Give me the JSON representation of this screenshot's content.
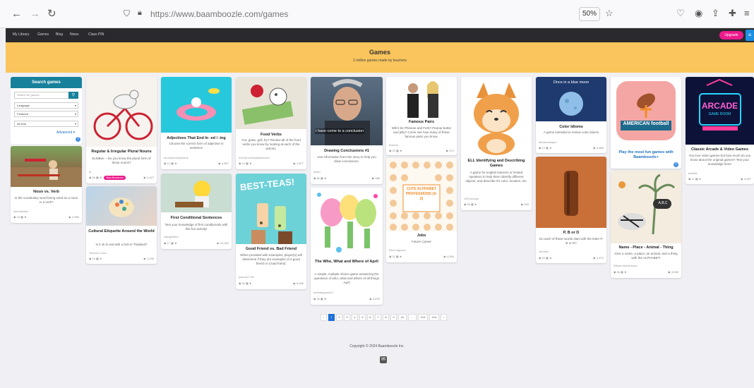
{
  "browser": {
    "url": "https://www.baamboozle.com/games",
    "zoom": "50%",
    "icons": [
      "back-arrow-icon",
      "forward-arrow-icon",
      "reload-icon",
      "shield-icon",
      "lock-icon",
      "star-icon",
      "pocket-icon",
      "account-icon",
      "share-icon",
      "extensions-icon",
      "menu-icon"
    ]
  },
  "nav": {
    "links": [
      "My Library",
      "Games",
      "Blog",
      "News",
      "Class PIN"
    ],
    "upgrade": "Upgrade",
    "menu_icon": "hamburger-icon"
  },
  "hero": {
    "title": "Games",
    "subtitle": "2 million games made by teachers"
  },
  "search": {
    "heading": "Search games",
    "placeholder": "Search for games",
    "language": "Language",
    "sort": "Featured",
    "time": "All time",
    "advanced": "Advanced",
    "help": "?"
  },
  "cards": [
    {
      "title": "Noun vs. Verb",
      "desc": "Is the vocabulary word being used as a noun or a verb?",
      "author": "wendaletele",
      "stats": "24",
      "plays": "2,980"
    },
    {
      "title": "Regular & Irregular Plural Nouns",
      "desc": "ELMBee – Do you know the plural form of these nouns?",
      "author": "bj",
      "stats": "9k",
      "badge": "Baa-Bonanza",
      "plays": "1,427"
    },
    {
      "title": "Cultural Etiquette Around the World",
      "desc": "Is it ok to eat with a fork in Thailand?",
      "author": "Teacher Cass",
      "stats": "1k",
      "plays": "1,239"
    },
    {
      "title": "Adjectives That End In -ed / -ing",
      "desc": "Choose the correct form of adjective in sentence",
      "author": "anonymousbyname",
      "stats": "12",
      "plays": "4,567"
    },
    {
      "title": "First Conditional Sentences",
      "desc": "Test your knowledge of first conditionals with this fun activity!",
      "author": "nategnfitkto",
      "stats": "17",
      "plays": "10,252"
    },
    {
      "title": "Food Verbs",
      "desc": "Cut, grate, grill, fry? Review all of the food verbs you know by looking at each of the actions.",
      "author": "morephonologtakeaction",
      "stats": "14",
      "plays": "1,877"
    },
    {
      "title": "Good Friend vs. Bad Friend",
      "desc": "When provided with examples, player(s) will determine if they are examples of a good friend or a bad friend.",
      "author": "jnstony7738",
      "stats": "3k",
      "plays": "5,696"
    },
    {
      "title": "Drawing Conclusions #1",
      "desc": "Use information from the story to help you draw conclusions.",
      "author": "rkildd",
      "stats": "6k",
      "plays": "986"
    },
    {
      "title": "The Who, What and Where of April",
      "desc": "A simple, multiple choice game answering the questions of who, what and where of all things April",
      "author": "birthdayquest11",
      "stats": "3k",
      "plays": "3,879"
    },
    {
      "title": "Famous Pairs",
      "desc": "Will it be Phineas and Ferb? Peanut butter and jelly? Come see how many of these famous pairs you know.",
      "author": "teacher",
      "stats": "22",
      "plays": "972"
    },
    {
      "title": "Jobs",
      "desc": "Future Career",
      "author": "Ellen Nguyen",
      "stats": "11",
      "plays": "4,994"
    },
    {
      "title": "ELL Identifying and Describing Games",
      "desc": "A game for english learners or limited speakers to help them identify different objects, and describe it's color, location, etc.",
      "author": "GBTuesday",
      "stats": "9k",
      "plays": "639"
    },
    {
      "title": "Color Idioms",
      "desc": "A game intended to review color idioms",
      "author": "aliciaadamjam",
      "stats": "10",
      "plays": "3,886"
    },
    {
      "title": "P, B or D",
      "desc": "Do each of these words start with the letter P, B or D?",
      "author": "Jennifer",
      "stats": "22",
      "plays": "1,672"
    },
    {
      "title": "Play the most fun games with Baamboozle+",
      "desc": "",
      "author": "",
      "stats": "",
      "plays": ""
    },
    {
      "title": "Name - Place - Animal - Thing",
      "desc": "Give a name, a place, an animal, and a thing with the ALPHABET!",
      "author": "ElMaa Mohammad",
      "stats": "9k",
      "plays": "3,596"
    },
    {
      "title": "Classic Arcade & Video Games",
      "desc": "You love video games but how much do you know about the original games? Test your knowledge here!",
      "author": "babilbb",
      "stats": "11",
      "plays": "4,907"
    }
  ],
  "image_text": {
    "once_in_a_blue_moon": "Once in a blue moon",
    "american_football": "AMERICAN football",
    "arcade": "ARCADE",
    "game_room": "GAME ROOM",
    "best_teas": "BEST-TEAS!",
    "drawing_caption": "I have come to a conclusion",
    "cute_professions": "CUTE ALPHABET PROFESSIONS (A-Z)",
    "abc": "A,B,C"
  },
  "pagination": [
    "‹",
    "1",
    "2",
    "3",
    "4",
    "5",
    "6",
    "7",
    "8",
    "9",
    "10",
    "...",
    "213",
    "214",
    "›"
  ],
  "footer": {
    "copyright": "Copyright © 2024 Baamboozle Inc."
  },
  "colors": {
    "accent": "#17819b",
    "brand": "#ec1a8c",
    "hero": "#f9c55c",
    "navbar": "#2a2a2e",
    "page": "#f0f0f4"
  }
}
